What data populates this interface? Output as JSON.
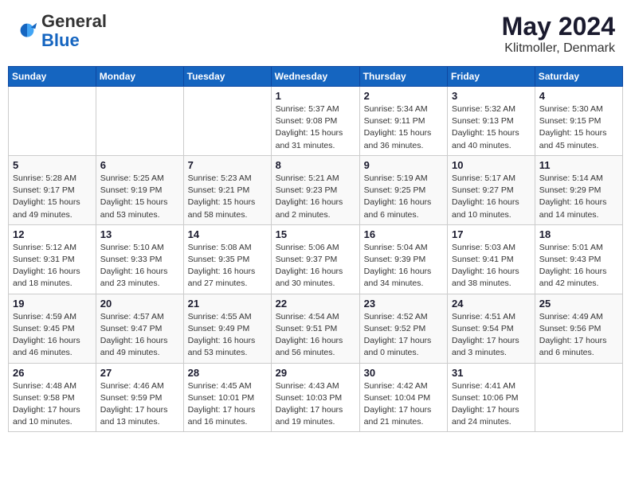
{
  "header": {
    "logo_general": "General",
    "logo_blue": "Blue",
    "title": "May 2024",
    "subtitle": "Klitmoller, Denmark"
  },
  "weekdays": [
    "Sunday",
    "Monday",
    "Tuesday",
    "Wednesday",
    "Thursday",
    "Friday",
    "Saturday"
  ],
  "weeks": [
    [
      {
        "day": "",
        "info": ""
      },
      {
        "day": "",
        "info": ""
      },
      {
        "day": "",
        "info": ""
      },
      {
        "day": "1",
        "info": "Sunrise: 5:37 AM\nSunset: 9:08 PM\nDaylight: 15 hours\nand 31 minutes."
      },
      {
        "day": "2",
        "info": "Sunrise: 5:34 AM\nSunset: 9:11 PM\nDaylight: 15 hours\nand 36 minutes."
      },
      {
        "day": "3",
        "info": "Sunrise: 5:32 AM\nSunset: 9:13 PM\nDaylight: 15 hours\nand 40 minutes."
      },
      {
        "day": "4",
        "info": "Sunrise: 5:30 AM\nSunset: 9:15 PM\nDaylight: 15 hours\nand 45 minutes."
      }
    ],
    [
      {
        "day": "5",
        "info": "Sunrise: 5:28 AM\nSunset: 9:17 PM\nDaylight: 15 hours\nand 49 minutes."
      },
      {
        "day": "6",
        "info": "Sunrise: 5:25 AM\nSunset: 9:19 PM\nDaylight: 15 hours\nand 53 minutes."
      },
      {
        "day": "7",
        "info": "Sunrise: 5:23 AM\nSunset: 9:21 PM\nDaylight: 15 hours\nand 58 minutes."
      },
      {
        "day": "8",
        "info": "Sunrise: 5:21 AM\nSunset: 9:23 PM\nDaylight: 16 hours\nand 2 minutes."
      },
      {
        "day": "9",
        "info": "Sunrise: 5:19 AM\nSunset: 9:25 PM\nDaylight: 16 hours\nand 6 minutes."
      },
      {
        "day": "10",
        "info": "Sunrise: 5:17 AM\nSunset: 9:27 PM\nDaylight: 16 hours\nand 10 minutes."
      },
      {
        "day": "11",
        "info": "Sunrise: 5:14 AM\nSunset: 9:29 PM\nDaylight: 16 hours\nand 14 minutes."
      }
    ],
    [
      {
        "day": "12",
        "info": "Sunrise: 5:12 AM\nSunset: 9:31 PM\nDaylight: 16 hours\nand 18 minutes."
      },
      {
        "day": "13",
        "info": "Sunrise: 5:10 AM\nSunset: 9:33 PM\nDaylight: 16 hours\nand 23 minutes."
      },
      {
        "day": "14",
        "info": "Sunrise: 5:08 AM\nSunset: 9:35 PM\nDaylight: 16 hours\nand 27 minutes."
      },
      {
        "day": "15",
        "info": "Sunrise: 5:06 AM\nSunset: 9:37 PM\nDaylight: 16 hours\nand 30 minutes."
      },
      {
        "day": "16",
        "info": "Sunrise: 5:04 AM\nSunset: 9:39 PM\nDaylight: 16 hours\nand 34 minutes."
      },
      {
        "day": "17",
        "info": "Sunrise: 5:03 AM\nSunset: 9:41 PM\nDaylight: 16 hours\nand 38 minutes."
      },
      {
        "day": "18",
        "info": "Sunrise: 5:01 AM\nSunset: 9:43 PM\nDaylight: 16 hours\nand 42 minutes."
      }
    ],
    [
      {
        "day": "19",
        "info": "Sunrise: 4:59 AM\nSunset: 9:45 PM\nDaylight: 16 hours\nand 46 minutes."
      },
      {
        "day": "20",
        "info": "Sunrise: 4:57 AM\nSunset: 9:47 PM\nDaylight: 16 hours\nand 49 minutes."
      },
      {
        "day": "21",
        "info": "Sunrise: 4:55 AM\nSunset: 9:49 PM\nDaylight: 16 hours\nand 53 minutes."
      },
      {
        "day": "22",
        "info": "Sunrise: 4:54 AM\nSunset: 9:51 PM\nDaylight: 16 hours\nand 56 minutes."
      },
      {
        "day": "23",
        "info": "Sunrise: 4:52 AM\nSunset: 9:52 PM\nDaylight: 17 hours\nand 0 minutes."
      },
      {
        "day": "24",
        "info": "Sunrise: 4:51 AM\nSunset: 9:54 PM\nDaylight: 17 hours\nand 3 minutes."
      },
      {
        "day": "25",
        "info": "Sunrise: 4:49 AM\nSunset: 9:56 PM\nDaylight: 17 hours\nand 6 minutes."
      }
    ],
    [
      {
        "day": "26",
        "info": "Sunrise: 4:48 AM\nSunset: 9:58 PM\nDaylight: 17 hours\nand 10 minutes."
      },
      {
        "day": "27",
        "info": "Sunrise: 4:46 AM\nSunset: 9:59 PM\nDaylight: 17 hours\nand 13 minutes."
      },
      {
        "day": "28",
        "info": "Sunrise: 4:45 AM\nSunset: 10:01 PM\nDaylight: 17 hours\nand 16 minutes."
      },
      {
        "day": "29",
        "info": "Sunrise: 4:43 AM\nSunset: 10:03 PM\nDaylight: 17 hours\nand 19 minutes."
      },
      {
        "day": "30",
        "info": "Sunrise: 4:42 AM\nSunset: 10:04 PM\nDaylight: 17 hours\nand 21 minutes."
      },
      {
        "day": "31",
        "info": "Sunrise: 4:41 AM\nSunset: 10:06 PM\nDaylight: 17 hours\nand 24 minutes."
      },
      {
        "day": "",
        "info": ""
      }
    ]
  ]
}
